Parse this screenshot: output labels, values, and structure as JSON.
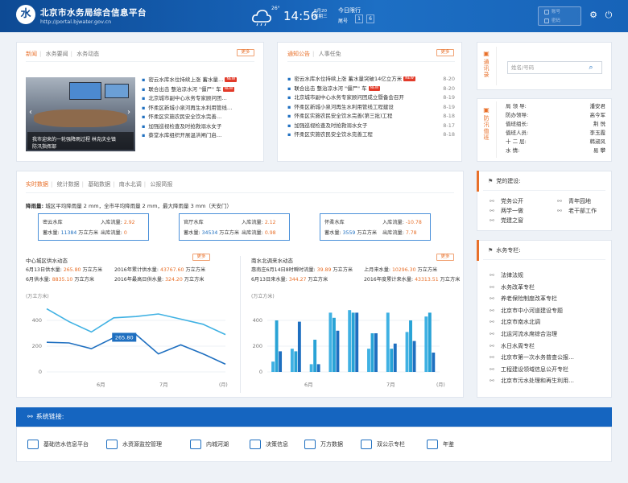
{
  "header": {
    "logo_glyph": "水",
    "title": "北京市水务局综合信息平台",
    "url": "http://portal.bjwater.gov.cn",
    "temperature": "26°",
    "time": "14:56",
    "date_line1": "8月20",
    "date_line2": "星期三",
    "limit_title": "今日限行",
    "limit_label": "尾号",
    "limit_numbers": [
      "1",
      "6"
    ],
    "username_placeholder": "账号",
    "password_placeholder": "密码",
    "icons": [
      "cloud-icon",
      "gear-icon",
      "power-icon"
    ]
  },
  "news": {
    "tabs": [
      "新闻",
      "水务要闻",
      "水务动态"
    ],
    "more": "更多",
    "photo_caption_line1": "我市迎来的一轮强降雨过程 林克庆全镇",
    "photo_caption_line2": "防汛指挥部",
    "items": [
      {
        "text": "密云水库水位持续上涨  蓄水量…",
        "new": true
      },
      {
        "text": "联合出击  整治凉水河 \"僵尸\" 车",
        "new": true
      },
      {
        "text": "北京城市副中心水务专家顾问团…",
        "new": false
      },
      {
        "text": "怀柔区新城小泉河再生水利用管线…",
        "new": false
      },
      {
        "text": "怀柔区实施农民安全饮水完善…",
        "new": false
      },
      {
        "text": "加强巡视检查及时抢救溺水女子",
        "new": false
      },
      {
        "text": "蔡堂水库组织开展温洪闸门启…",
        "new": false
      }
    ],
    "new_label": "NEW"
  },
  "notices": {
    "tabs": [
      "通知公告",
      "人事任免"
    ],
    "more": "更多",
    "new_label": "NEW",
    "items": [
      {
        "text": "密云水库水位持续上涨 蓄水量突破14亿立方米",
        "date": "8-20",
        "new": true
      },
      {
        "text": "联合出击 整治凉水河 \"僵尸\" 车",
        "date": "8-20",
        "new": true
      },
      {
        "text": "北京城市副中心水务专家顾问团成立暨备会召开",
        "date": "8-19",
        "new": false
      },
      {
        "text": "怀柔区新城小泉河再生水利用管线工程建设",
        "date": "8-19",
        "new": false
      },
      {
        "text": "怀柔区实施农民安全饮水完善(第三批)工程",
        "date": "8-18",
        "new": false
      },
      {
        "text": "加强巡视检查及时抢救溺水女子",
        "date": "8-17",
        "new": false
      },
      {
        "text": "怀柔区实施农民安全饮水完善工程",
        "date": "8-18",
        "new": false
      }
    ]
  },
  "contacts": {
    "title": "通讯录",
    "search_placeholder": "姓名/号码"
  },
  "duty": {
    "title": "防汛值班",
    "rows": [
      {
        "role": "局 领 导:",
        "name": "潘安君"
      },
      {
        "role": "防办领导:",
        "name": "高今军"
      },
      {
        "role": "值班组长:",
        "name": "荆 悦"
      },
      {
        "role": "值班人员:",
        "name": "李玉霞"
      },
      {
        "role": "十 二 层:",
        "name": "韩淑风"
      },
      {
        "role": "水      情:",
        "name": "易 攀"
      }
    ]
  },
  "party": {
    "title": "党的建设:",
    "items": [
      "党务公开",
      "青年园地",
      "两学一做",
      "老干部工作",
      "党建之窗"
    ]
  },
  "column": {
    "title": "水务专栏:",
    "items": [
      "法律法规",
      "水务改革专栏",
      "养老保险制度改革专栏",
      "北京市中小河道建设专题",
      "北京市南水北调",
      "北运河流水席综合治理",
      "水日水周专栏",
      "北京市第一次水务普查公报…",
      "工程建设领域信息公开专栏",
      "北京市污水处理和再生利用…"
    ]
  },
  "realtime": {
    "tabs": [
      "实时数据",
      "统计数据",
      "基础数据",
      "南水北调",
      "公报简报"
    ],
    "rainfall_label": "降雨量:",
    "rainfall_text": "城区平均降雨量 2 mm，全市平均降雨量 2 mm，最大降雨量 3 mm（天安门）",
    "reservoirs": [
      {
        "name": "密云水库",
        "inflow_label": "入库流量:",
        "inflow": "2.92",
        "storage_label": "蓄水量:",
        "storage": "11384",
        "storage_unit": "万立方米",
        "outflow_label": "出库流量:",
        "outflow": "0"
      },
      {
        "name": "官厅水库",
        "inflow_label": "入库流量:",
        "inflow": "2.12",
        "storage_label": "蓄水量:",
        "storage": "34534",
        "storage_unit": "万立方米",
        "outflow_label": "出库流量:",
        "outflow": "0.98"
      },
      {
        "name": "怀柔水库",
        "inflow_label": "入库流量:",
        "inflow": "-10.78",
        "storage_label": "蓄水量:",
        "storage": "3559",
        "storage_unit": "万立方米",
        "outflow_label": "出库流量:",
        "outflow": "7.78"
      }
    ]
  },
  "supply": {
    "title": "中心城区供水动态",
    "more": "更多",
    "stats": [
      {
        "label": "6月13日供水量:",
        "value": "265.80",
        "unit": "万立方米"
      },
      {
        "label": "2016年累计供水量:",
        "value": "43767.60",
        "unit": "万立方米"
      },
      {
        "label": "6月供水量:",
        "value": "8835.10",
        "unit": "万立方米"
      },
      {
        "label": "2016年最高日供水量:",
        "value": "324.20",
        "unit": "万立方米"
      }
    ]
  },
  "south": {
    "title": "南水北调来水动态",
    "more": "更多",
    "stats": [
      {
        "label": "惠南庄6月14日8时瞬时流量:",
        "value": "39.89",
        "unit": "万立方米"
      },
      {
        "label": "上月来水量:",
        "value": "10296.30",
        "unit": "万立方米"
      },
      {
        "label": "6月13日来水量:",
        "value": "344.27",
        "unit": "万立方米"
      },
      {
        "label": "2016年度累计来水量:",
        "value": "43313.51",
        "unit": "万立方米"
      }
    ]
  },
  "chart_data": [
    {
      "type": "line",
      "ylabel": "(万立方米)",
      "ylim": [
        0,
        400
      ],
      "yticks": [
        0,
        200,
        400
      ],
      "x_tick_labels": [
        "6月",
        "7月"
      ],
      "x_unit": "(月)",
      "x": [
        0,
        1,
        2,
        3,
        4,
        5,
        6,
        7,
        8
      ],
      "series": [
        {
          "values": [
            490,
            390,
            310,
            420,
            430,
            450,
            410,
            370,
            290
          ],
          "color": "#3fb1e3"
        },
        {
          "values": [
            230,
            225,
            180,
            265.8,
            290,
            140,
            210,
            140,
            60
          ],
          "color": "#1e6fc0"
        }
      ],
      "tooltip": {
        "index": 3,
        "text": "265.80"
      }
    },
    {
      "type": "bar",
      "ylabel": "(万立方米)",
      "ylim": [
        0,
        400
      ],
      "yticks": [
        0,
        200,
        400
      ],
      "x_tick_labels": [
        "6月",
        "7月"
      ],
      "x_unit": "(月)",
      "series": [
        {
          "values": [
            80,
            180,
            60,
            460,
            480,
            180,
            460,
            310,
            430
          ],
          "color": "#3fb1e3"
        },
        {
          "values": [
            400,
            160,
            250,
            420,
            460,
            300,
            180,
            400,
            460
          ],
          "color": "#29a3d6"
        },
        {
          "values": [
            160,
            390,
            60,
            320,
            460,
            300,
            220,
            240,
            150
          ],
          "color": "#1e6fc0"
        }
      ]
    }
  ],
  "footer": {
    "title": "系统链接:",
    "links": [
      {
        "label": "基础信水信息平台",
        "icon": "monitor-icon"
      },
      {
        "label": "水资源监控管理",
        "icon": "gauge-icon"
      },
      {
        "label": "内城河湖",
        "icon": "river-icon"
      },
      {
        "label": "决策信息",
        "icon": "decision-icon"
      },
      {
        "label": "万方数据",
        "icon": "cube-icon"
      },
      {
        "label": "双公示专栏",
        "icon": "publish-icon"
      },
      {
        "label": "年鉴",
        "icon": "yearbook-icon"
      }
    ]
  }
}
